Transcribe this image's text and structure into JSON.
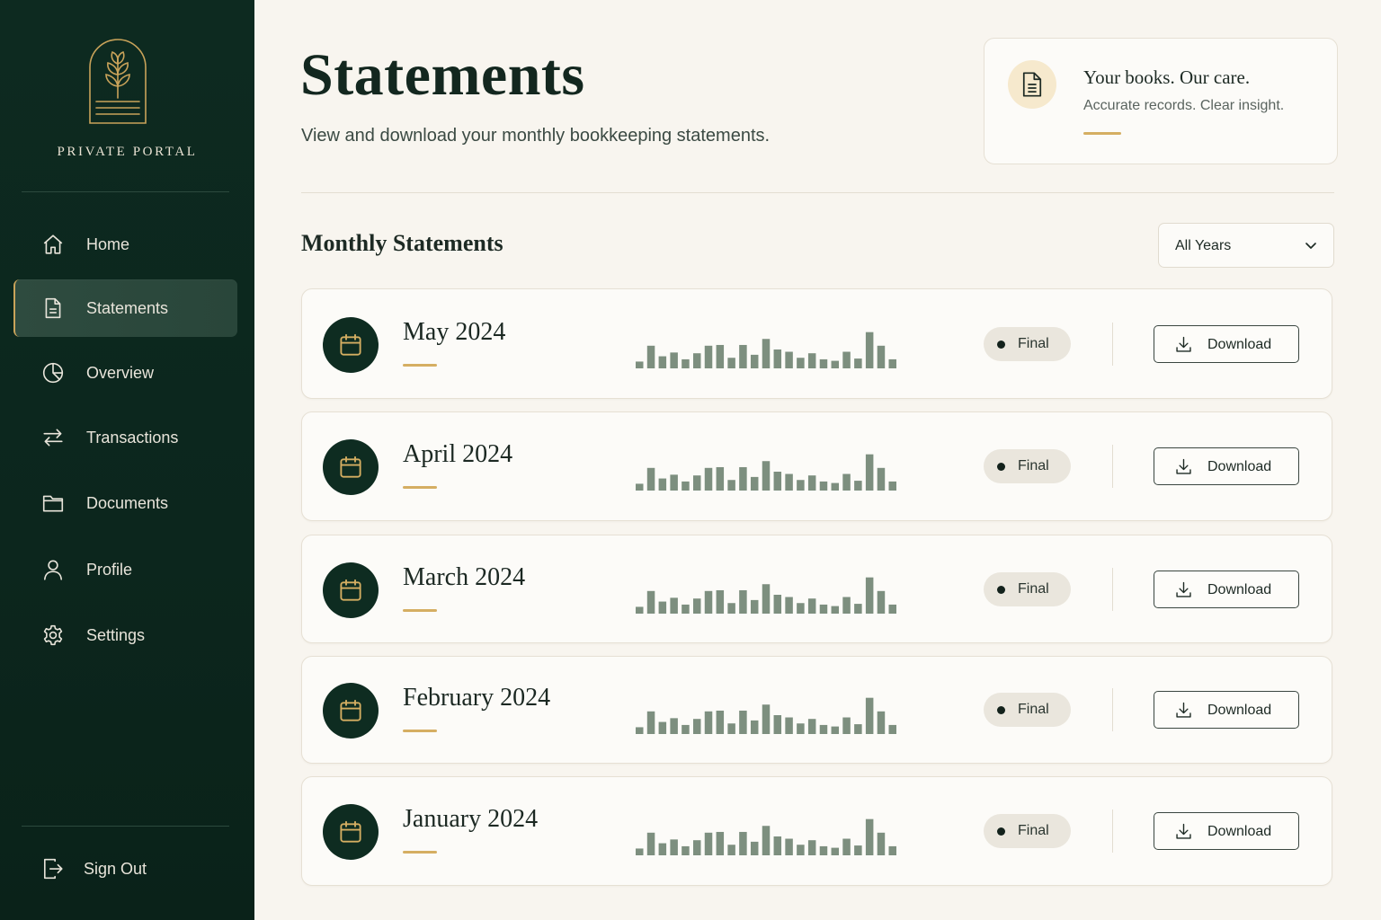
{
  "brand": {
    "name": "PRIVATE PORTAL",
    "logo_icon": "sprout-arch-logo"
  },
  "colors": {
    "sidebar_bg": "#0d2a20",
    "accent_gold": "#d5ae62",
    "page_bg": "#f8f5ef",
    "spark_bar": "#7d8f7f"
  },
  "sidebar": {
    "items": [
      {
        "label": "Home",
        "icon": "home-icon",
        "active": false
      },
      {
        "label": "Statements",
        "icon": "document-icon",
        "active": true
      },
      {
        "label": "Overview",
        "icon": "pie-chart-icon",
        "active": false
      },
      {
        "label": "Transactions",
        "icon": "transfer-arrows-icon",
        "active": false
      },
      {
        "label": "Documents",
        "icon": "folder-icon",
        "active": false
      },
      {
        "label": "Profile",
        "icon": "user-icon",
        "active": false
      },
      {
        "label": "Settings",
        "icon": "gear-icon",
        "active": false
      }
    ],
    "sign_out": "Sign Out"
  },
  "header": {
    "title": "Statements",
    "subtitle": "View and download your monthly bookkeeping statements."
  },
  "care_card": {
    "title": "Your books. Our care.",
    "subtitle": "Accurate records. Clear insight."
  },
  "section": {
    "title": "Monthly Statements",
    "year_filter": "All Years"
  },
  "statements": [
    {
      "month": "May 2024",
      "status": "Final",
      "action": "Download"
    },
    {
      "month": "April 2024",
      "status": "Final",
      "action": "Download"
    },
    {
      "month": "March 2024",
      "status": "Final",
      "action": "Download"
    },
    {
      "month": "February 2024",
      "status": "Final",
      "action": "Download"
    },
    {
      "month": "January 2024",
      "status": "Final",
      "action": "Download"
    }
  ],
  "sparkline_levels": [
    0.18,
    0.6,
    0.32,
    0.42,
    0.24,
    0.4,
    0.6,
    0.62,
    0.28,
    0.62,
    0.36,
    0.78,
    0.5,
    0.44,
    0.28,
    0.4,
    0.24,
    0.2,
    0.44,
    0.26,
    0.96,
    0.6,
    0.24
  ]
}
